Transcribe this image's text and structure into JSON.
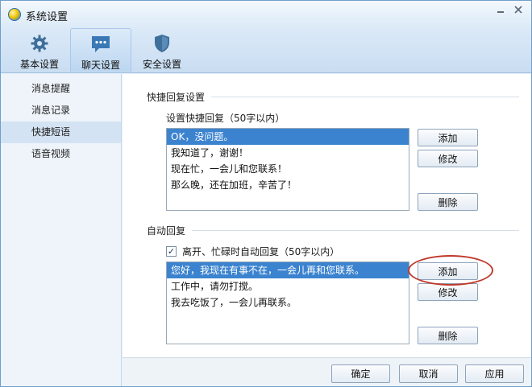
{
  "window": {
    "title": "系统设置"
  },
  "tabs": [
    {
      "label": "基本设置",
      "icon": "gear-icon"
    },
    {
      "label": "聊天设置",
      "icon": "chat-bubble-icon"
    },
    {
      "label": "安全设置",
      "icon": "shield-icon"
    }
  ],
  "sidebar": {
    "items": [
      {
        "label": "消息提醒"
      },
      {
        "label": "消息记录"
      },
      {
        "label": "快捷短语"
      },
      {
        "label": "语音视频"
      }
    ]
  },
  "quick_reply": {
    "section_title": "快捷回复设置",
    "subtitle": "设置快捷回复（50字以内）",
    "items": [
      "OK，没问题。",
      "我知道了，谢谢！",
      "现在忙，一会儿和您联系！",
      "那么晚，还在加班，辛苦了！"
    ],
    "add_label": "添加",
    "edit_label": "修改",
    "delete_label": "删除"
  },
  "auto_reply": {
    "section_title": "自动回复",
    "checkbox_label": "离开、忙碌时自动回复（50字以内）",
    "checkbox_mark": "✓",
    "items": [
      "您好，我现在有事不在，一会儿再和您联系。",
      "工作中，请勿打搅。",
      "我去吃饭了，一会儿再联系。"
    ],
    "add_label": "添加",
    "edit_label": "修改",
    "delete_label": "删除"
  },
  "footer": {
    "ok_label": "确定",
    "cancel_label": "取消",
    "apply_label": "应用"
  },
  "colors": {
    "selection": "#3b83cf",
    "highlight_ring": "#c0392b",
    "accent": "#1f6cb8"
  }
}
